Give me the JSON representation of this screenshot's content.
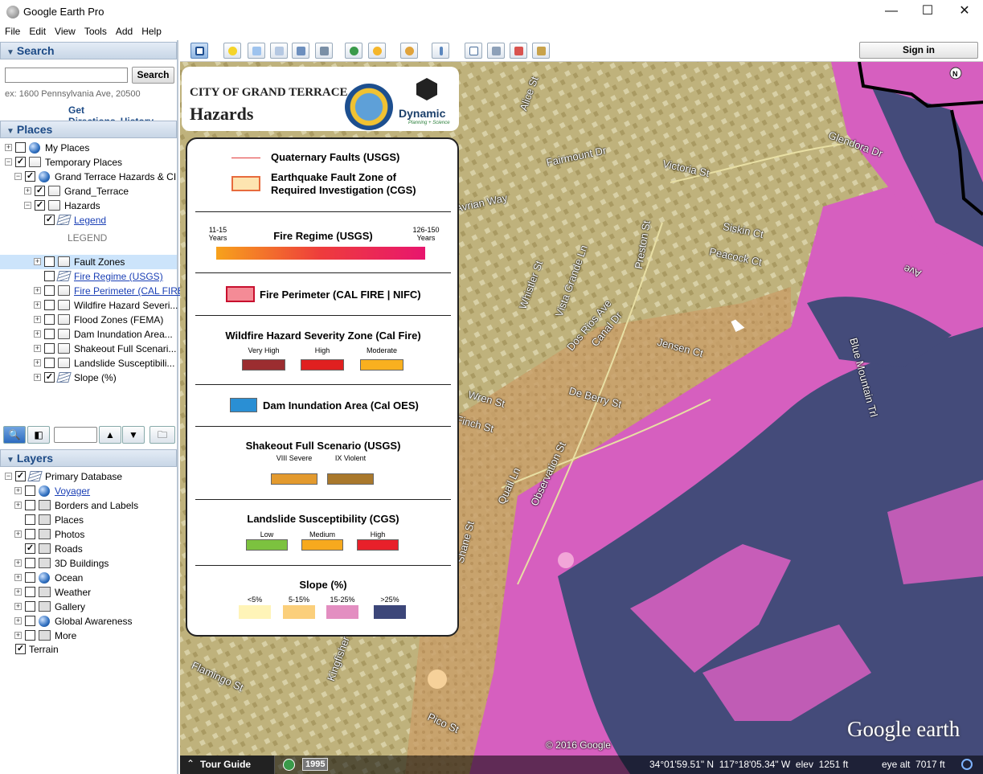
{
  "window": {
    "title": "Google Earth Pro",
    "min": "—",
    "max": "☐",
    "close": "✕"
  },
  "menu": [
    "File",
    "Edit",
    "View",
    "Tools",
    "Add",
    "Help"
  ],
  "search": {
    "header": "Search",
    "value": "",
    "button": "Search",
    "hint": "ex: 1600 Pennsylvania Ave, 20500",
    "get_directions": "Get Directions",
    "history": "History"
  },
  "places": {
    "header": "Places",
    "items": [
      {
        "label": "My Places",
        "indent": 0,
        "pm": "+",
        "checked": false,
        "icon": "globe",
        "link": false
      },
      {
        "label": "Temporary Places",
        "indent": 0,
        "pm": "−",
        "checked": true,
        "icon": "folder",
        "link": false
      },
      {
        "label": "Grand Terrace Hazards & CI",
        "indent": 1,
        "pm": "−",
        "checked": true,
        "icon": "globe",
        "link": false
      },
      {
        "label": "Grand_Terrace",
        "indent": 2,
        "pm": "+",
        "checked": true,
        "icon": "folder",
        "link": false
      },
      {
        "label": "Hazards",
        "indent": 2,
        "pm": "−",
        "checked": true,
        "icon": "folder",
        "link": false
      },
      {
        "label": "Legend",
        "indent": 3,
        "pm": "",
        "checked": true,
        "icon": "layer",
        "link": true
      },
      {
        "label": "LEGEND",
        "indent": 4,
        "pm": "",
        "checked": null,
        "icon": "",
        "link": false,
        "grey": true
      },
      {
        "label": "Fault Zones",
        "indent": 3,
        "pm": "+",
        "checked": false,
        "icon": "folder",
        "link": false,
        "selected": true
      },
      {
        "label": "Fire Regime (USGS)",
        "indent": 3,
        "pm": "",
        "checked": false,
        "icon": "layer",
        "link": true
      },
      {
        "label": "Fire Perimeter (CAL FIRE",
        "indent": 3,
        "pm": "+",
        "checked": false,
        "icon": "folder",
        "link": true
      },
      {
        "label": "Wildfire Hazard Severi...",
        "indent": 3,
        "pm": "+",
        "checked": false,
        "icon": "folder",
        "link": false
      },
      {
        "label": "Flood Zones (FEMA)",
        "indent": 3,
        "pm": "+",
        "checked": false,
        "icon": "folder",
        "link": false
      },
      {
        "label": "Dam Inundation Area...",
        "indent": 3,
        "pm": "+",
        "checked": false,
        "icon": "folder",
        "link": false
      },
      {
        "label": "Shakeout Full Scenari...",
        "indent": 3,
        "pm": "+",
        "checked": false,
        "icon": "folder",
        "link": false
      },
      {
        "label": "Landslide Susceptibili...",
        "indent": 3,
        "pm": "+",
        "checked": false,
        "icon": "folder",
        "link": false
      },
      {
        "label": "Slope (%)",
        "indent": 3,
        "pm": "+",
        "checked": true,
        "icon": "layer",
        "link": false
      }
    ]
  },
  "layers": {
    "header": "Layers",
    "items": [
      {
        "label": "Primary Database",
        "indent": 0,
        "pm": "−",
        "checked": true,
        "icon": "layer",
        "link": false
      },
      {
        "label": "Voyager",
        "indent": 1,
        "pm": "+",
        "checked": false,
        "icon": "globe",
        "link": true
      },
      {
        "label": "Borders and Labels",
        "indent": 1,
        "pm": "+",
        "checked": false,
        "icon": "sq",
        "link": false
      },
      {
        "label": "Places",
        "indent": 1,
        "pm": "",
        "checked": false,
        "icon": "sq",
        "link": false
      },
      {
        "label": "Photos",
        "indent": 1,
        "pm": "+",
        "checked": false,
        "icon": "sq",
        "link": false
      },
      {
        "label": "Roads",
        "indent": 1,
        "pm": "",
        "checked": true,
        "icon": "sq",
        "link": false
      },
      {
        "label": "3D Buildings",
        "indent": 1,
        "pm": "+",
        "checked": false,
        "icon": "sq",
        "link": false
      },
      {
        "label": "Ocean",
        "indent": 1,
        "pm": "+",
        "checked": false,
        "icon": "globe",
        "link": false
      },
      {
        "label": "Weather",
        "indent": 1,
        "pm": "+",
        "checked": false,
        "icon": "sq",
        "link": false
      },
      {
        "label": "Gallery",
        "indent": 1,
        "pm": "+",
        "checked": false,
        "icon": "sq",
        "link": false
      },
      {
        "label": "Global Awareness",
        "indent": 1,
        "pm": "+",
        "checked": false,
        "icon": "globe",
        "link": false
      },
      {
        "label": "More",
        "indent": 1,
        "pm": "+",
        "checked": false,
        "icon": "sq",
        "link": false
      },
      {
        "label": "Terrain",
        "indent": 0,
        "pm": "",
        "checked": true,
        "icon": "",
        "link": false
      }
    ]
  },
  "toolbar": {
    "sign_in": "Sign in"
  },
  "legend": {
    "city": "CITY OF GRAND TERRACE",
    "sub": "Hazards",
    "brand": "Dynamic",
    "brand_sub": "Planning + Science",
    "faults": "Quaternary Faults (USGS)",
    "ezone": "Earthquake Fault Zone of Required Investigation (CGS)",
    "fire_regime": "Fire Regime (USGS)",
    "fr_left": "11-15 Years",
    "fr_right": "126-150 Years",
    "fire_perimeter": "Fire Perimeter (CAL FIRE | NIFC)",
    "whsz": "Wildfire Hazard Severity Zone (Cal Fire)",
    "whsz_items": [
      "Very High",
      "High",
      "Moderate"
    ],
    "dam": "Dam Inundation Area (Cal OES)",
    "shake": "Shakeout Full Scenario (USGS)",
    "shake_items": [
      "VIII Severe",
      "IX Violent"
    ],
    "landslide": "Landslide Susceptibility (CGS)",
    "ls_items": [
      "Low",
      "Medium",
      "High"
    ],
    "slope": "Slope (%)",
    "slope_items": [
      "<5%",
      "5-15%",
      "15-25%",
      ">25%"
    ],
    "colors": {
      "very_high": "#9b2d30",
      "high": "#e02020",
      "moderate": "#f9b01f",
      "severe": "#e39a2e",
      "violent": "#a9782c",
      "low": "#7cc23f",
      "medium": "#f7a91e",
      "ls_high": "#e8202a",
      "s1": "#fff4b8",
      "s2": "#fbcf7b",
      "s3": "#e38ec1",
      "s4": "#3c4679",
      "dam": "#2a8fd4"
    }
  },
  "map": {
    "copyright": "© 2016 Google",
    "watermark": "Google earth",
    "tour_guide": "Tour Guide",
    "year": "1995",
    "coords": "34°01'59.51\" N  117°18'05.34\" W  elev  1251 ft",
    "eye_alt": "eye alt  7017 ft",
    "streets": [
      "Glendora Dr",
      "Fairmount Dr",
      "Victoria St",
      "Siskin Ct",
      "Peacock Ct",
      "Preston St",
      "Whistler St",
      "Vista Grande Ln",
      "Dos Rios Ave",
      "Canal Dr",
      "Jensen Ct",
      "De Berry St",
      "Wren St",
      "Finch St",
      "Observation St",
      "Quail Ln",
      "Blue Mountain Trl",
      "Flamingo St",
      "Kingfisher",
      "Pico St",
      "Shane St",
      "Avrian Way",
      "Alice St",
      "Ave"
    ]
  }
}
